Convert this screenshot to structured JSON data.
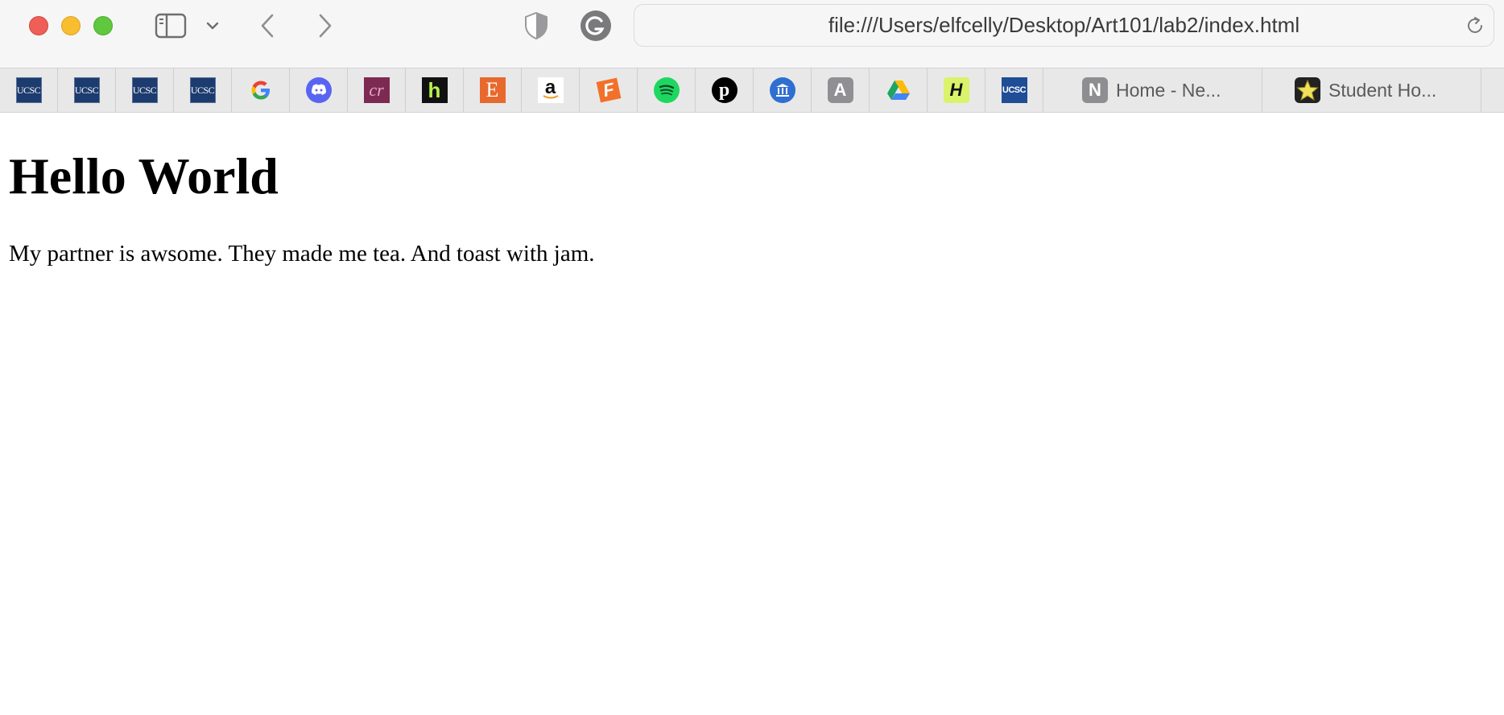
{
  "address_bar": {
    "url": "file:///Users/elfcelly/Desktop/Art101/lab2/index.html"
  },
  "favorites": [
    {
      "icon": "ucsc-icon",
      "text": "UCSC"
    },
    {
      "icon": "ucsc-icon",
      "text": "UCSC"
    },
    {
      "icon": "ucsc-icon",
      "text": "UCSC"
    },
    {
      "icon": "ucsc-icon",
      "text": "UCSC"
    },
    {
      "icon": "google-icon",
      "text": "G"
    },
    {
      "icon": "discord-icon"
    },
    {
      "icon": "cp-icon",
      "text": "cr"
    },
    {
      "icon": "handshake-icon",
      "text": "h"
    },
    {
      "icon": "etsy-icon",
      "text": "E"
    },
    {
      "icon": "amazon-icon",
      "text": "a"
    },
    {
      "icon": "fandango-icon",
      "text": "F"
    },
    {
      "icon": "spotify-icon"
    },
    {
      "icon": "pinterest-icon",
      "text": "p"
    },
    {
      "icon": "library-icon"
    },
    {
      "icon": "a-icon",
      "text": "A"
    },
    {
      "icon": "google-drive-icon"
    },
    {
      "icon": "h-icon",
      "text": "H"
    },
    {
      "icon": "ucsc-icon",
      "text": "UCSC"
    }
  ],
  "tabs": [
    {
      "icon": "notion-icon",
      "icon_text": "N",
      "label": "Home - Ne..."
    },
    {
      "icon": "star-icon",
      "label": "Student Ho..."
    }
  ],
  "page": {
    "heading": "Hello World",
    "paragraph": "My partner is awsome. They made me tea. And toast with jam."
  },
  "colors": {
    "close": "#ee5f58",
    "minimize": "#f9be2f",
    "zoom": "#60c83f",
    "ucsc_blue": "#1c3b6e"
  }
}
